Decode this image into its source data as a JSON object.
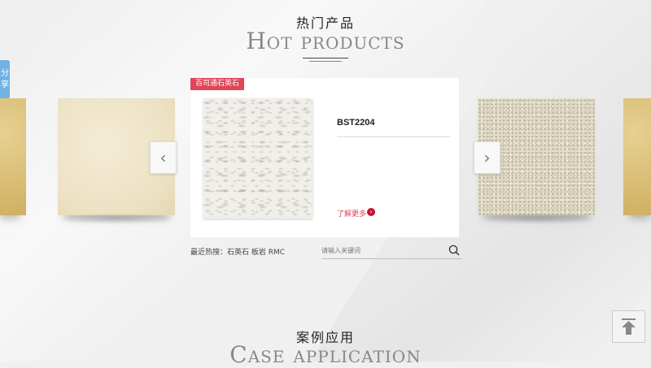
{
  "hot": {
    "title_cn": "热门产品",
    "title_en": "Hot products"
  },
  "share": {
    "label": "分享"
  },
  "carousel": {
    "badge": "百司通石英石",
    "product_name": "BST2204",
    "more_label": "了解更多",
    "prev_icon": "chevron-left-icon",
    "next_icon": "chevron-right-icon"
  },
  "search": {
    "recent": "最近热搜：石英石 板岩 RMC",
    "placeholder": "请输入关键词"
  },
  "case": {
    "title_cn": "案例应用",
    "title_en": "Case application"
  },
  "colors": {
    "badge": "#e24557",
    "more_arrow": "#c8102e",
    "share_tab": "#6fb3e3"
  }
}
